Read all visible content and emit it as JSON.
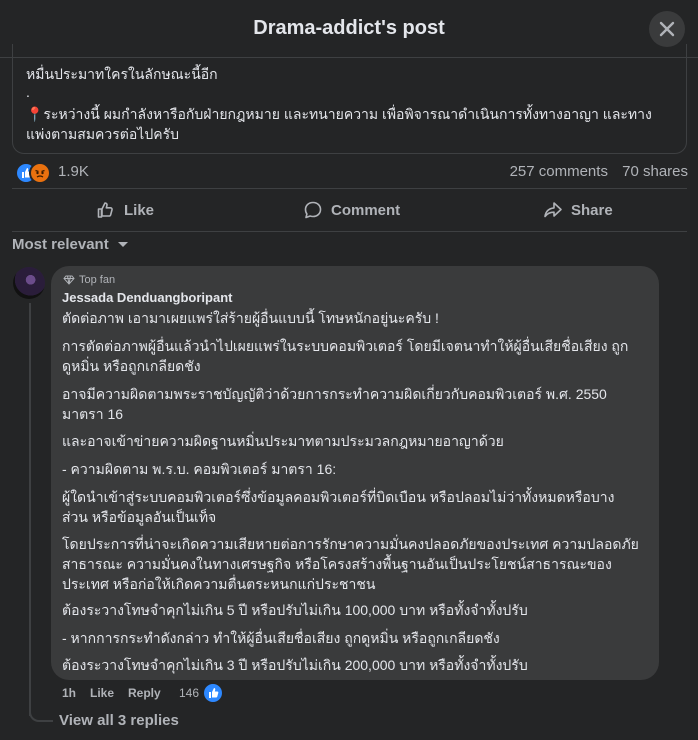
{
  "header": {
    "title": "Drama-addict's post"
  },
  "post": {
    "lines": [
      "หมื่นประมาทใครในลักษณะนี้อีก",
      ".",
      "📍ระหว่างนี้ ผมกำลังหารือกับฝ่ายกฎหมาย และทนายความ เพื่อพิจารณาดำเนินการทั้งทางอาญา และทาง",
      "แพ่งตามสมควรต่อไปครับ"
    ]
  },
  "stats": {
    "reactions_count": "1.9K",
    "comments": "257 comments",
    "shares": "70 shares"
  },
  "actions": {
    "like": "Like",
    "comment": "Comment",
    "share": "Share"
  },
  "sort": {
    "label": "Most relevant"
  },
  "comment": {
    "badge": "Top fan",
    "author": "Jessada Denduangboripant",
    "lines": [
      "ตัดต่อภาพ เอามาเผยแพร่ใส่ร้ายผู้อื่นแบบนี้ โทษหนักอยู่นะครับ !",
      "การตัดต่อภาพผู้อื่นแล้วนำไปเผยแพร่ในระบบคอมพิวเตอร์ โดยมีเจตนาทำให้ผู้อื่นเสียชื่อเสียง ถูก",
      "ดูหมิ่น หรือถูกเกลียดชัง",
      "อาจมีความผิดตามพระราชบัญญัติว่าด้วยการกระทำความผิดเกี่ยวกับคอมพิวเตอร์ พ.ศ. 2550",
      "มาตรา 16",
      "และอาจเข้าข่ายความผิดฐานหมิ่นประมาทตามประมวลกฎหมายอาญาด้วย",
      "- ความผิดตาม พ.ร.บ. คอมพิวเตอร์ มาตรา 16:",
      "ผู้ใดนำเข้าสู่ระบบคอมพิวเตอร์ซึ่งข้อมูลคอมพิวเตอร์ที่บิดเบือน หรือปลอมไม่ว่าทั้งหมดหรือบาง",
      "ส่วน หรือข้อมูลอันเป็นเท็จ",
      "โดยประการที่น่าจะเกิดความเสียหายต่อการรักษาความมั่นคงปลอดภัยของประเทศ ความปลอดภัย",
      "สาธารณะ ความมั่นคงในทางเศรษฐกิจ หรือโครงสร้างพื้นฐานอันเป็นประโยชน์สาธารณะของ",
      "ประเทศ หรือก่อให้เกิดความตื่นตระหนกแก่ประชาชน",
      "ต้องระวางโทษจำคุกไม่เกิน 5 ปี หรือปรับไม่เกิน 100,000 บาท หรือทั้งจำทั้งปรับ",
      "- หากการกระทำดังกล่าว ทำให้ผู้อื่นเสียชื่อเสียง ถูกดูหมิ่น หรือถูกเกลียดชัง",
      "ต้องระวางโทษจำคุกไม่เกิน 3 ปี หรือปรับไม่เกิน 200,000 บาท หรือทั้งจำทั้งปรับ"
    ],
    "time": "1h",
    "like_label": "Like",
    "reply_label": "Reply",
    "likes": "146",
    "view_replies": "View all 3 replies"
  },
  "colors": {
    "background": "#242526",
    "bubble": "#3a3b3c",
    "text": "#e4e6eb",
    "secondary": "#b0b3b8",
    "like_blue": "#2d88ff",
    "angry_orange": "#e9710f"
  }
}
